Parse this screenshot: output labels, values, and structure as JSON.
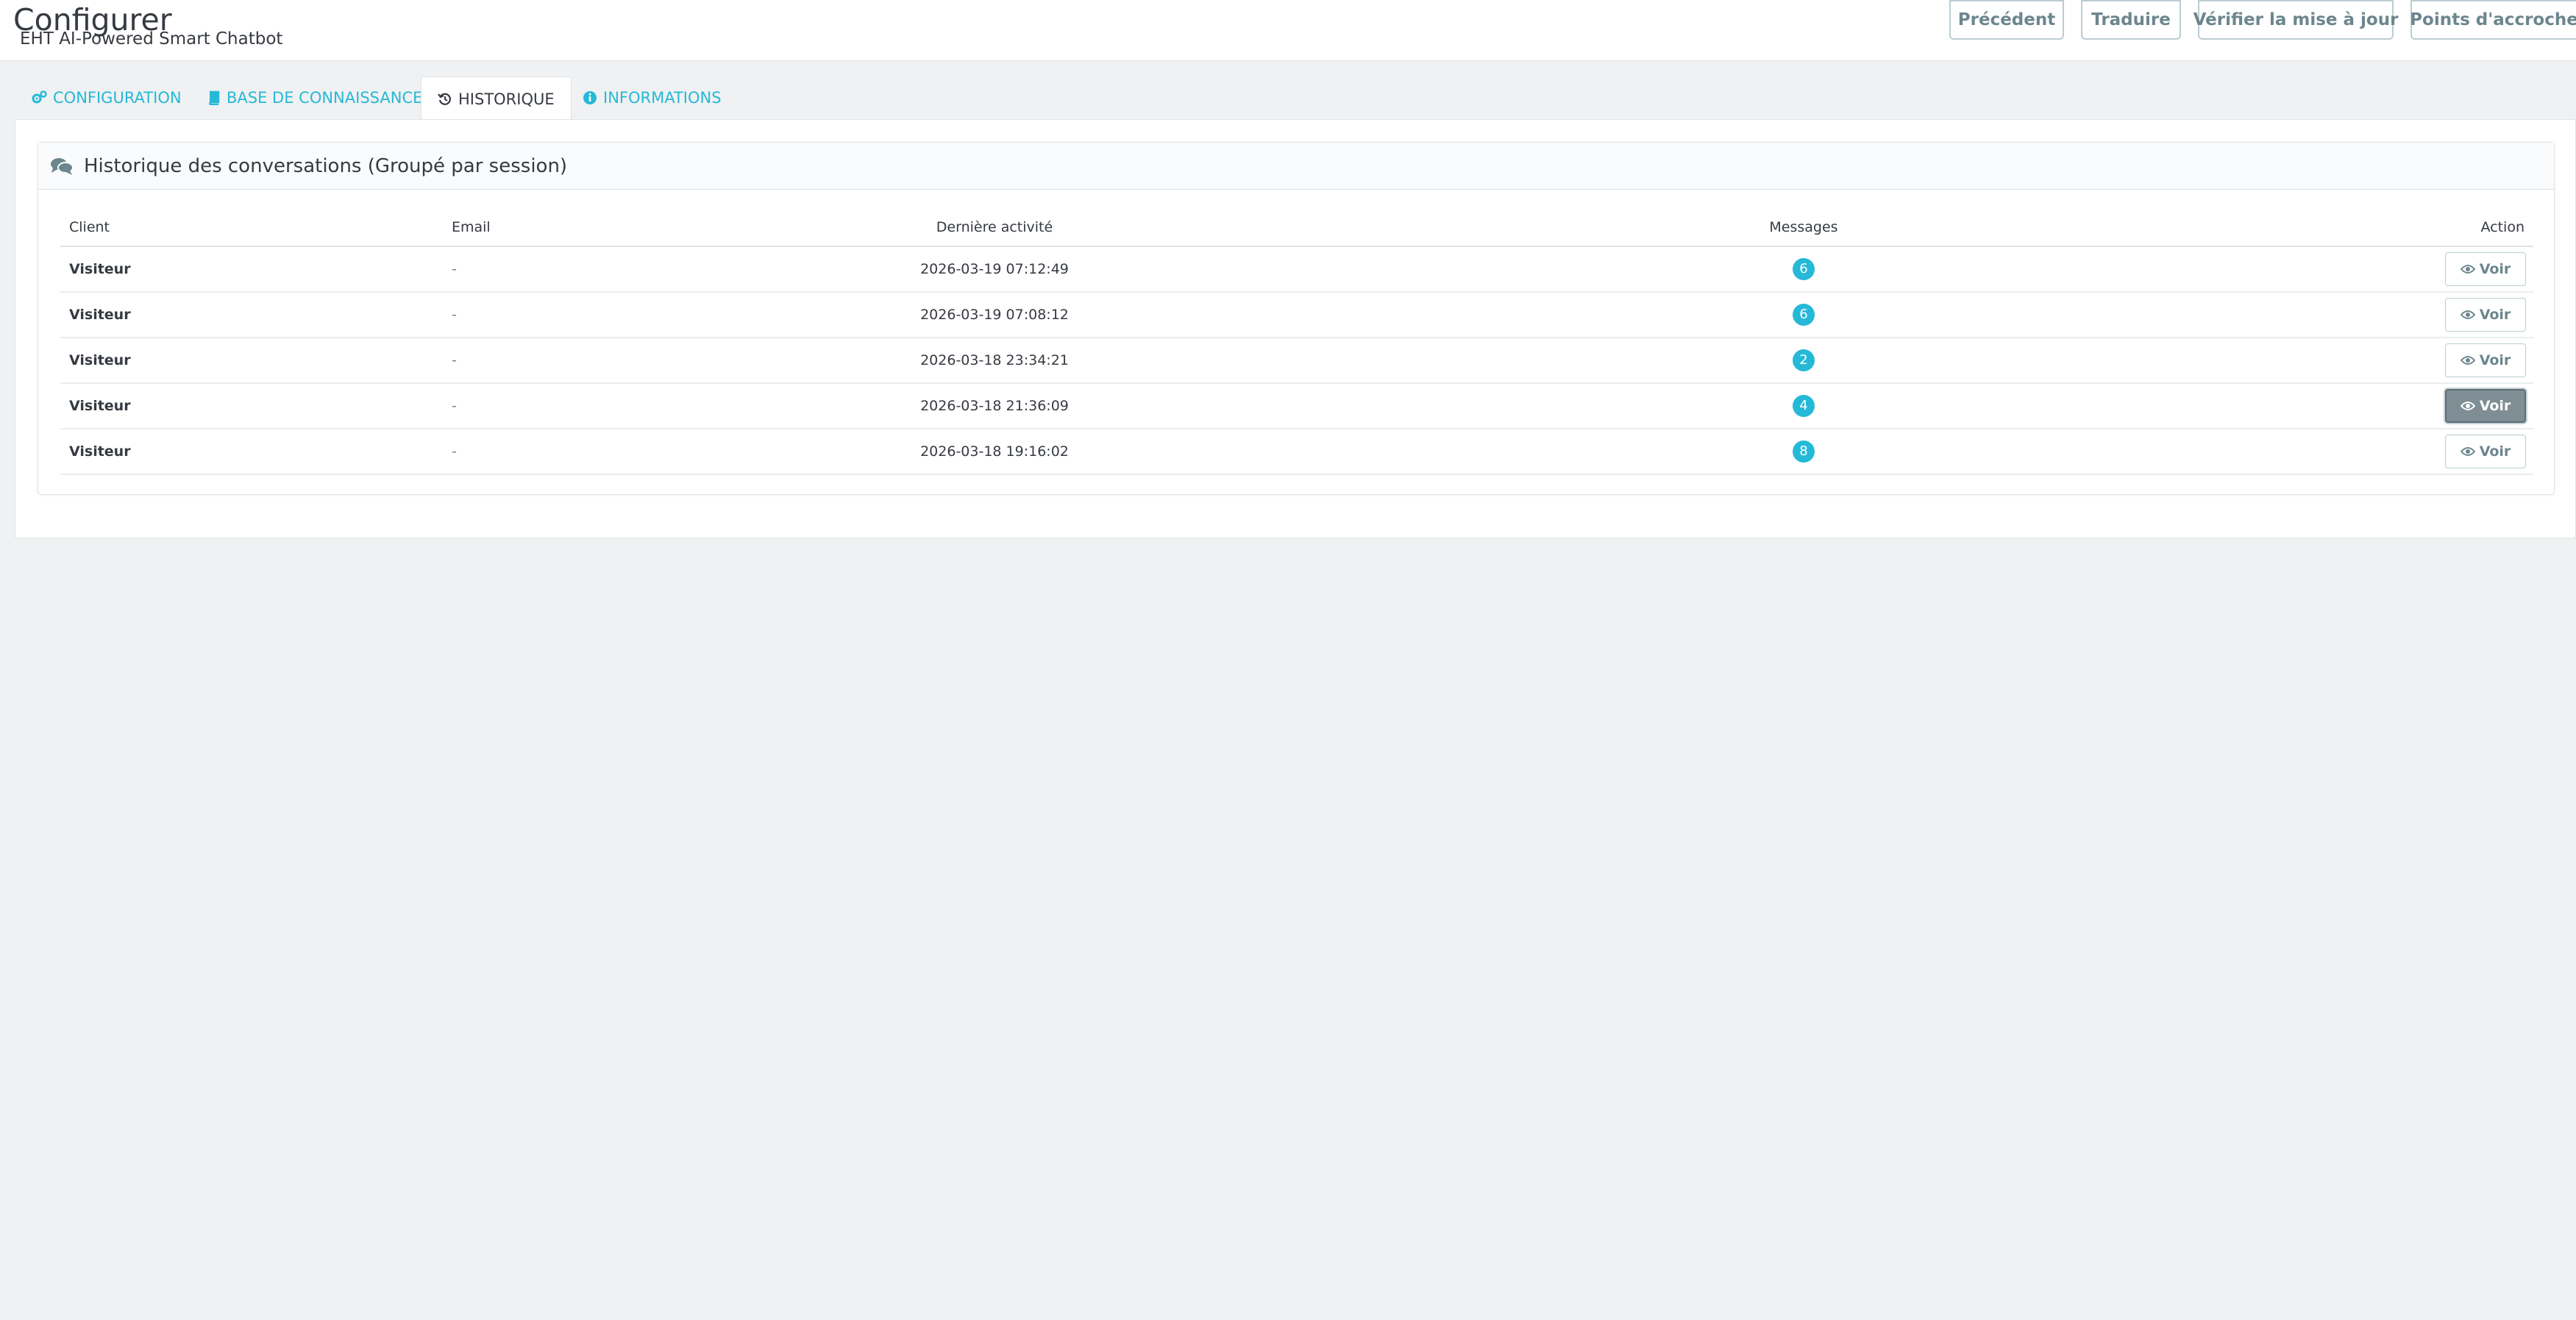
{
  "header": {
    "title": "Configurer",
    "subtitle": "EHT AI-Powered Smart Chatbot",
    "toolbar": {
      "previous": "Précédent",
      "translate": "Traduire",
      "check_update": "Vérifier la mise à jour",
      "hooks": "Points d'accroche"
    }
  },
  "tabs": [
    {
      "label": "CONFIGURATION",
      "icon": "gears-icon"
    },
    {
      "label": "BASE DE CONNAISSANCES",
      "icon": "book-icon"
    },
    {
      "label": "HISTORIQUE",
      "icon": "history-icon",
      "active": true
    },
    {
      "label": "INFORMATIONS",
      "icon": "info-icon"
    }
  ],
  "panel": {
    "title": "Historique des conversations (Groupé par session)",
    "icon": "comments-icon"
  },
  "table": {
    "headers": {
      "client": "Client",
      "email": "Email",
      "last_activity": "Dernière activité",
      "messages": "Messages",
      "action": "Action"
    },
    "rows": [
      {
        "client": "Visiteur",
        "email": "-",
        "date": "2026-03-19 07:12:49",
        "messages": "6",
        "action": "Voir"
      },
      {
        "client": "Visiteur",
        "email": "-",
        "date": "2026-03-19 07:08:12",
        "messages": "6",
        "action": "Voir"
      },
      {
        "client": "Visiteur",
        "email": "-",
        "date": "2026-03-18 23:34:21",
        "messages": "2",
        "action": "Voir"
      },
      {
        "client": "Visiteur",
        "email": "-",
        "date": "2026-03-18 21:36:09",
        "messages": "4",
        "action": "Voir"
      },
      {
        "client": "Visiteur",
        "email": "-",
        "date": "2026-03-18 19:16:02",
        "messages": "8",
        "action": "Voir"
      }
    ]
  },
  "colors": {
    "accent": "#25b9d7",
    "background": "#eff1f2",
    "button_border": "#bbcdd2",
    "active_button": "#7e8e94"
  }
}
